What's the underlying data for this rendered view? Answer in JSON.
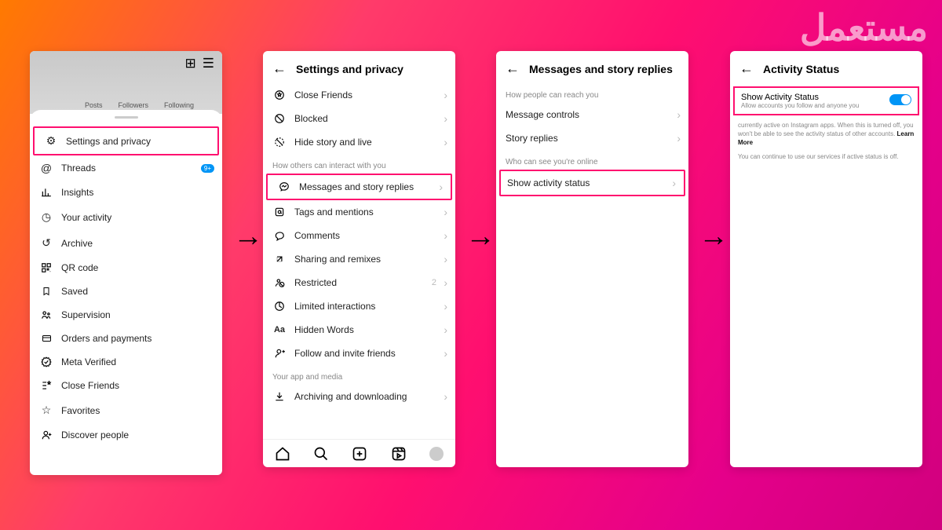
{
  "watermark": "مستعمل",
  "screen1": {
    "top_tabs": {
      "posts": "Posts",
      "followers": "Followers",
      "following": "Following"
    },
    "items": [
      {
        "label": "Settings and privacy",
        "hl": true
      },
      {
        "label": "Threads",
        "badge": "9+"
      },
      {
        "label": "Insights"
      },
      {
        "label": "Your activity"
      },
      {
        "label": "Archive"
      },
      {
        "label": "QR code"
      },
      {
        "label": "Saved"
      },
      {
        "label": "Supervision"
      },
      {
        "label": "Orders and payments"
      },
      {
        "label": "Meta Verified"
      },
      {
        "label": "Close Friends"
      },
      {
        "label": "Favorites"
      },
      {
        "label": "Discover people"
      }
    ]
  },
  "screen2": {
    "title": "Settings and privacy",
    "g1": [
      {
        "label": "Close Friends"
      },
      {
        "label": "Blocked"
      },
      {
        "label": "Hide story and live"
      }
    ],
    "sect2": "How others can interact with you",
    "g2": [
      {
        "label": "Messages and story replies",
        "hl": true
      },
      {
        "label": "Tags and mentions"
      },
      {
        "label": "Comments"
      },
      {
        "label": "Sharing and remixes"
      },
      {
        "label": "Restricted",
        "count": "2"
      },
      {
        "label": "Limited interactions"
      },
      {
        "label": "Hidden Words",
        "iconTxt": "Aa"
      },
      {
        "label": "Follow and invite friends"
      }
    ],
    "sect3": "Your app and media",
    "g3": [
      {
        "label": "Archiving and downloading"
      }
    ]
  },
  "screen3": {
    "title": "Messages and story replies",
    "sect1": "How people can reach you",
    "g1": [
      {
        "label": "Message controls"
      },
      {
        "label": "Story replies"
      }
    ],
    "sect2": "Who can see you're online",
    "g2": [
      {
        "label": "Show activity status",
        "hl": true
      }
    ]
  },
  "screen4": {
    "title": "Activity Status",
    "toggle_label": "Show Activity Status",
    "toggle_sub": "Allow accounts you follow and anyone you",
    "desc1": "currently active on Instagram apps. When this is turned off, you won't be able to see the activity status of other accounts. ",
    "learn": "Learn More",
    "desc2": "You can continue to use our services if active status is off."
  }
}
